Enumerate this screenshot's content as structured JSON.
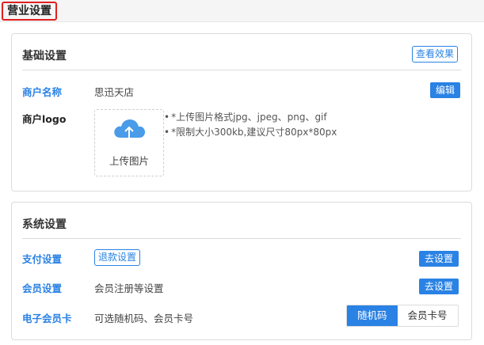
{
  "page": {
    "title": "营业设置"
  },
  "basic": {
    "title": "基础设置",
    "preview_label": "查看效果",
    "merchant_name_label": "商户名称",
    "merchant_name_value": "思迅天店",
    "edit_label": "编辑",
    "logo_label": "商户logo",
    "upload_label": "上传图片",
    "hints": [
      "*上传图片格式jpg、jpeg、png、gif",
      "*限制大小300kb,建议尺寸80px*80px"
    ]
  },
  "system": {
    "title": "系统设置",
    "payment_label": "支付设置",
    "refund_label": "退款设置",
    "payment_action": "去设置",
    "member_label": "会员设置",
    "member_value": "会员注册等设置",
    "member_action": "去设置",
    "ecard_label": "电子会员卡",
    "ecard_value": "可选随机码、会员卡号",
    "ecard_options": [
      "随机码",
      "会员卡号"
    ],
    "ecard_selected": "随机码"
  },
  "colors": {
    "accent": "#2a82e4",
    "highlight_border": "#e02020"
  },
  "icons": {
    "upload": "cloud-upload-icon"
  }
}
